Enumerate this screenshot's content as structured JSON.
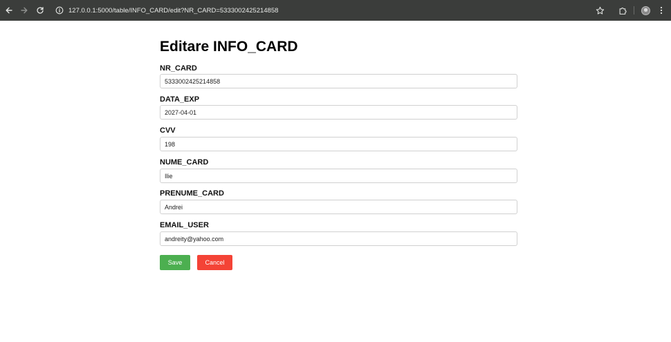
{
  "browser": {
    "url": "127.0.0.1:5000/table/INFO_CARD/edit?NR_CARD=5333002425214858",
    "icons": {
      "back": "arrow-left-icon",
      "forward": "arrow-right-icon",
      "reload": "reload-icon",
      "site_info": "site-info-icon",
      "bookmark": "star-icon",
      "extensions": "puzzle-icon",
      "profile": "avatar",
      "menu": "kebab-menu-icon"
    }
  },
  "form": {
    "title": "Editare INFO_CARD",
    "fields": [
      {
        "label": "NR_CARD",
        "value": "5333002425214858"
      },
      {
        "label": "DATA_EXP",
        "value": "2027-04-01"
      },
      {
        "label": "CVV",
        "value": "198"
      },
      {
        "label": "NUME_CARD",
        "value": "Ilie"
      },
      {
        "label": "PRENUME_CARD",
        "value": "Andrei"
      },
      {
        "label": "EMAIL_USER",
        "value": "andreity@yahoo.com"
      }
    ],
    "save_label": "Save",
    "cancel_label": "Cancel"
  },
  "colors": {
    "chrome_bg": "#3b3d3b",
    "save_button": "#4caf50",
    "cancel_button": "#f44336"
  }
}
